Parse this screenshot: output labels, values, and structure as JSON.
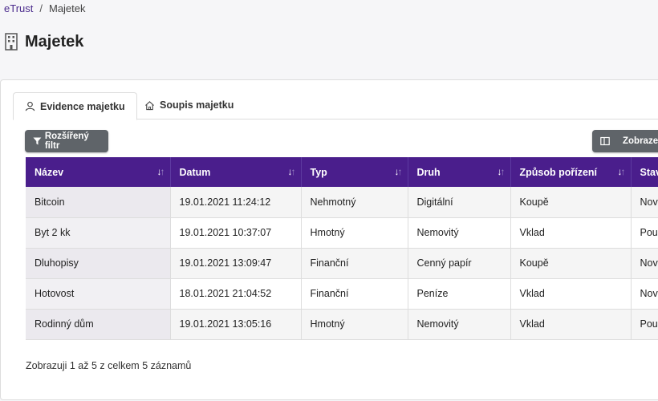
{
  "breadcrumb": {
    "root": "eTrust",
    "separator": "/",
    "current": "Majetek"
  },
  "page": {
    "title": "Majetek"
  },
  "tabs": [
    {
      "label": "Evidence majetku",
      "active": true,
      "icon": "user-icon"
    },
    {
      "label": "Soupis majetku",
      "active": false,
      "icon": "home-icon"
    }
  ],
  "toolbar": {
    "filter_label": "Rozšířený filtr",
    "display_label": "Zobrazen"
  },
  "table": {
    "columns": [
      "Název",
      "Datum",
      "Typ",
      "Druh",
      "Způsob pořízení",
      "Stav"
    ],
    "rows": [
      [
        "Bitcoin",
        "19.01.2021 11:24:12",
        "Nehmotný",
        "Digitální",
        "Koupě",
        "Novy"
      ],
      [
        "Byt 2 kk",
        "19.01.2021 10:37:07",
        "Hmotný",
        "Nemovitý",
        "Vklad",
        "Použ"
      ],
      [
        "Dluhopisy",
        "19.01.2021 13:09:47",
        "Finanční",
        "Cenný papír",
        "Koupě",
        "Novy"
      ],
      [
        "Hotovost",
        "18.01.2021 21:04:52",
        "Finanční",
        "Peníze",
        "Vklad",
        "Novy"
      ],
      [
        "Rodinný dům",
        "19.01.2021 13:05:16",
        "Hmotný",
        "Nemovitý",
        "Vklad",
        "Použ"
      ]
    ]
  },
  "pagination": {
    "info": "Zobrazuji 1 až 5 z celkem 5 záznamů"
  },
  "colors": {
    "header_bg": "#4a1e8c",
    "button_bg": "#5f6469",
    "link": "#4a2a8c"
  }
}
